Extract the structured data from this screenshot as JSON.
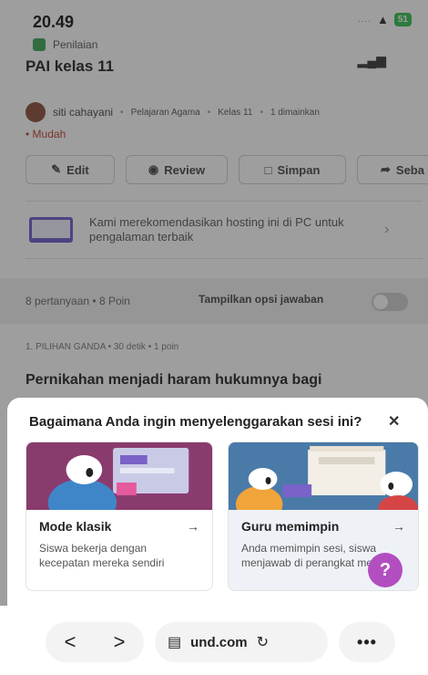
{
  "status": {
    "time": "20.49",
    "battery": "51"
  },
  "page": {
    "assessment_label": "Penilaian",
    "title": "PAI kelas 11",
    "author": "siti cahayani",
    "subject": "Pelajaran Agama",
    "grade": "Kelas 11",
    "plays": "1 dimainkan",
    "difficulty": "Mudah",
    "actions": {
      "edit": "Edit",
      "review": "Review",
      "save": "Simpan",
      "share": "Seba"
    },
    "banner": "Kami merekomendasikan hosting ini di PC untuk pengalaman terbaik",
    "question_count": "8 pertanyaan",
    "points": "8 Poin",
    "show_answers": "Tampilkan opsi jawaban",
    "question_type": "1. PILIHAN GANDA",
    "question_time": "30 detik",
    "question_points": "1 poin",
    "question_text": "Pernikahan menjadi haram hukumnya bagi"
  },
  "sheet": {
    "title": "Bagaimana Anda ingin menyelenggarakan sesi ini?",
    "close": "✕",
    "modes": [
      {
        "title": "Mode klasik",
        "arrow": "→",
        "desc": "Siswa bekerja dengan kecepatan mereka sendiri"
      },
      {
        "title": "Guru memimpin",
        "arrow": "→",
        "desc": "Anda memimpin sesi, siswa menjawab di perangkat mereka"
      }
    ],
    "help": "?"
  },
  "browser": {
    "back": "<",
    "forward": ">",
    "url": "und.com",
    "more": "•••"
  },
  "colors": {
    "accent_purple": "#b34ec0",
    "classic_bg": "#8a3b6e",
    "teacher_bg": "#4a7aa8",
    "difficulty": "#c0392b"
  }
}
